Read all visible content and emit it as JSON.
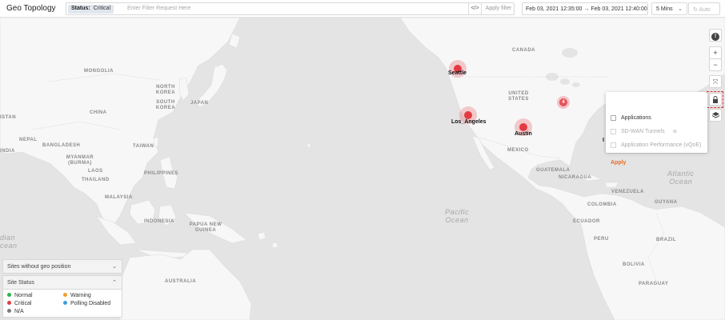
{
  "header": {
    "title": "Geo Topology",
    "filter": {
      "chip_label": "Status:",
      "chip_value": "Critical",
      "placeholder": "Enter Filter Request Here",
      "code_label": "</>",
      "apply_label": "Apply filter"
    },
    "time_range": "Feb 03, 2021 12:35:00 → Feb 03, 2021 12:40:00",
    "interval": {
      "value": "5 Mins",
      "chevron": "⌄"
    },
    "auto_label": "↻ Auto"
  },
  "map": {
    "regions": {
      "mongolia": "MONGOLIA",
      "china": "CHINA",
      "north_korea": "NORTH KOREA",
      "south_korea": "SOUTH KOREA",
      "japan": "JAPAN",
      "nepal": "NEPAL",
      "bangladesh": "BANGLADESH",
      "taiwan": "TAIWAN",
      "myanmar": "MYANMAR (BURMA)",
      "laos": "LAOS",
      "thailand": "THAILAND",
      "philippines": "PHILIPPINES",
      "malaysia": "MALAYSIA",
      "indonesia": "INDONESIA",
      "papua_new_guinea": "PAPUA NEW GUINEA",
      "australia": "AUSTRALIA",
      "asia_left": "ISTAN",
      "india_left": "INDIA",
      "canada": "CANADA",
      "united_states": "UNITED STATES",
      "mexico": "MEXICO",
      "guatemala": "GUATEMALA",
      "nicaragua": "NICARAGUA",
      "venezuela": "VENEZUELA",
      "colombia": "COLOMBIA",
      "ecuador": "ECUADOR",
      "peru": "PERU",
      "bolivia": "BOLIVIA",
      "brazil": "BRAZIL",
      "paraguay": "PARAGUAY",
      "guyana": "GUYANA"
    },
    "oceans": {
      "pacific_1": "Pacific",
      "pacific_2": "Ocean",
      "atlantic_1": "Atlantic",
      "atlantic_2": "Ocean",
      "indian_1": "dian",
      "indian_2": "cean"
    },
    "markers": {
      "seattle": "Seattle",
      "los_angeles": "Los_Angeles",
      "austin": "Austin",
      "cluster_count": "4"
    },
    "partial_label": "I"
  },
  "controls": {
    "info": "!",
    "zoom_in": "+",
    "zoom_out": "−",
    "fit": "⤧",
    "lock": "🔒",
    "layers": "◈"
  },
  "layers_menu": {
    "items": [
      {
        "label": "Applications",
        "enabled": true
      },
      {
        "label": "SD-WAN Tunnels",
        "enabled": false
      },
      {
        "label": "Application Performance (vQoE)",
        "enabled": false
      }
    ],
    "apply_label": "Apply"
  },
  "legend": {
    "sites_without_geo": "Sites without geo position",
    "site_status": "Site Status",
    "items": {
      "normal": "Normal",
      "critical": "Critical",
      "na": "N/A",
      "warning": "Warning",
      "polling_disabled": "Polling Disabled"
    },
    "colors": {
      "normal": "#2eb34a",
      "critical": "#e33b43",
      "na": "#7b7b7b",
      "warning": "#f0a02a",
      "polling_disabled": "#3f9fdc"
    }
  }
}
